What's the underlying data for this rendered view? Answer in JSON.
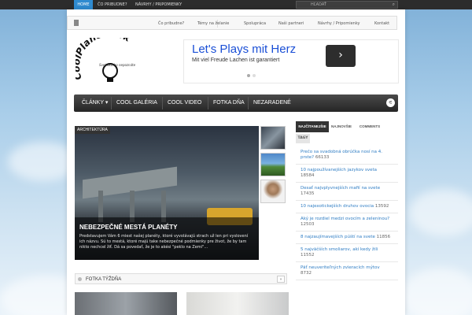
{
  "topbar": {
    "home": "HOME",
    "links": [
      "ČO PRIBUDNE?",
      "NÁVRHY / PRIPOMIENKY"
    ],
    "search_placeholder": "HĽADAŤ"
  },
  "subnav": {
    "items": [
      "Čo pribudne?",
      "Témy na želanie",
      "Spolupráca",
      "Naši partneri",
      "Návrhy / Pripomienky",
      "Kontakt"
    ]
  },
  "logo": {
    "text": "CoolPlaneta.sk",
    "tagline": "Svet ako ho nepoznáte"
  },
  "ad": {
    "headline": "Let's Plays mit Herz",
    "subline": "Mit viel Freude Lachen ist garantiert",
    "arrow": "›"
  },
  "mainnav": {
    "items": [
      "ČLÁNKY ▾",
      "COOL GALÉRIA",
      "COOL VIDEO",
      "FOTKA DŇA",
      "NEZARADENÉ"
    ],
    "share_icon": "share-icon"
  },
  "feature": {
    "category": "ARCHITEKTÚRA",
    "title": "NEBEZPEČNÉ MESTÁ PLANÉTY",
    "excerpt": "Predstavujem Vám 6 miest našej planéty, ktoré vyvolávajú strach už len pri vyslovení ich názvu. Sú to mestá, ktoré majú take nebezpečné podmienky pre život, že by tam nikto nechcel žiť. Dá sa povedať, že je to akési \"peklo na Zemi\"..."
  },
  "sidebar": {
    "tabs": [
      "NAJČÍTANEJŠIE",
      "NAJNOVŠIE",
      "COMMENTS"
    ],
    "tags_tab": "TAGY",
    "items": [
      {
        "title": "Prečo sa svadobná obrúčka nosí na 4. prste?",
        "count": "66133"
      },
      {
        "title": "10 najpoužívanejších jazykov sveta",
        "count": "18584"
      },
      {
        "title": "Desať najvplyvnejších mafií na svete",
        "count": "17435"
      },
      {
        "title": "10 najexotickejších druhov ovocia",
        "count": "13592"
      },
      {
        "title": "Aký je rozdiel medzi ovocím a zeleninou?",
        "count": "12503"
      },
      {
        "title": "8 najzaujímavejších púští na svete",
        "count": "11856"
      },
      {
        "title": "5 najväčších smoliarov, akí kedy žili",
        "count": "11552"
      },
      {
        "title": "Päť neuveriteľných zvieracích mýtov",
        "count": "8732"
      }
    ]
  },
  "fotka": {
    "label": "FOTKA TÝŽDŇA",
    "arrow": "»"
  }
}
